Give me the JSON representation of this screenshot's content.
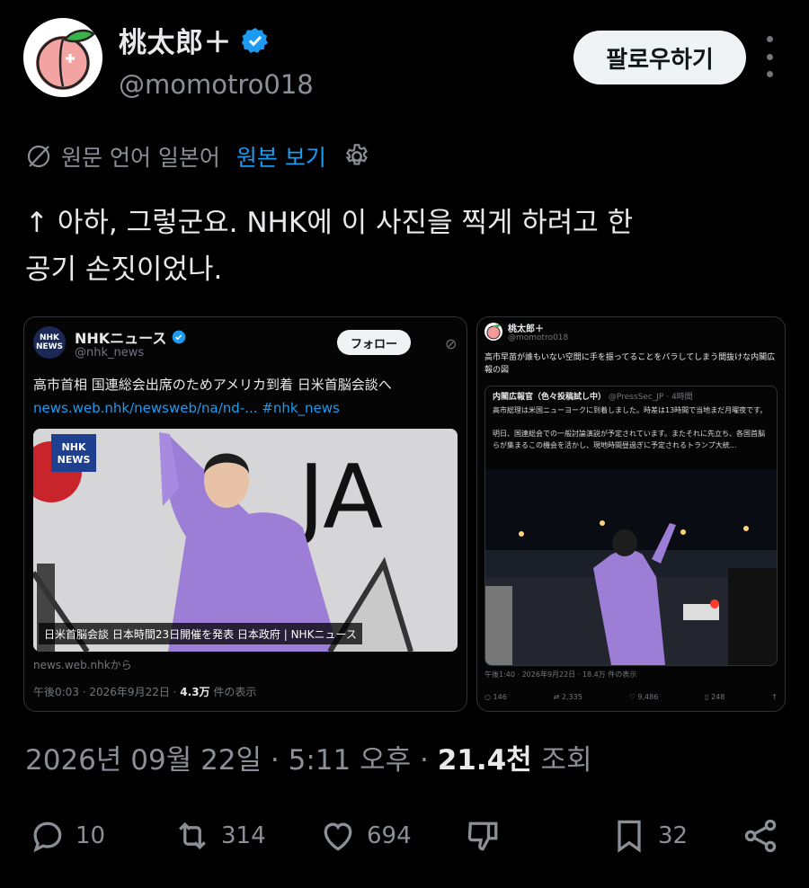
{
  "author": {
    "name": "桃太郎＋",
    "handle": "@momotro018",
    "follow_label": "팔로우하기"
  },
  "translation": {
    "label": "원문 언어 일본어",
    "link": "원본 보기"
  },
  "tweet_text": "↑  아하, 그렇군요. NHK에 이 사진을 찍게 하려고 한\n공기 손짓이었나.",
  "embed1": {
    "logo_text": "NHK\nNEWS",
    "name": "NHKニュース",
    "handle": "@nhk_news",
    "follow": "フォロー",
    "title": "高市首相 国連総会出席のためアメリカ到着 日米首脳会談へ",
    "link": "news.web.nhk/newsweb/na/nd-... #nhk_news",
    "photo_badge": "NHK\nNEWS",
    "photo_letters": "JA",
    "caption": "日米首脳会談 日本時間23日開催を発表 日本政府 | NHKニュース",
    "source": "news.web.nhkから",
    "meta_time": "午後0:03 · 2026年9月22日 · ",
    "meta_views": "4.3万",
    "meta_views_suffix": " 件の表示"
  },
  "embed2": {
    "name": "桃太郎＋",
    "handle": "@momotro018",
    "text": "高市早苗が誰もいない空間に手を振ってることをバラしてしまう間抜けな内閣広報の図",
    "quote_head": "内閣広報官（色々投稿試し中）",
    "quote_handle": "@PressSec_JP · 4時間",
    "quote_text": "高市総理は米国ニューヨークに到着しました。時差は13時間で当地まだ月曜夜です。\n\n明日、国連総会での一般討論演説が予定されています。またそれに先立ち、各国首脳らが集まるこの機会を活かし、現地時間昼過ぎに予定されるトランプ大統...",
    "meta": "午後1:40 · 2026年9月22日 · 18.4万 件の表示",
    "stats": [
      "146",
      "2,335",
      "9,486",
      "248"
    ]
  },
  "footer": {
    "date": "2026년 09월 22일 · 5:11 오후 · ",
    "views": "21.4천",
    "views_suffix": " 조회"
  },
  "actions": {
    "replies": "10",
    "reposts": "314",
    "likes": "694",
    "bookmarks": "32"
  },
  "colors": {
    "background": "#000000",
    "accent": "#1d9bf0",
    "muted": "#8b9096"
  }
}
